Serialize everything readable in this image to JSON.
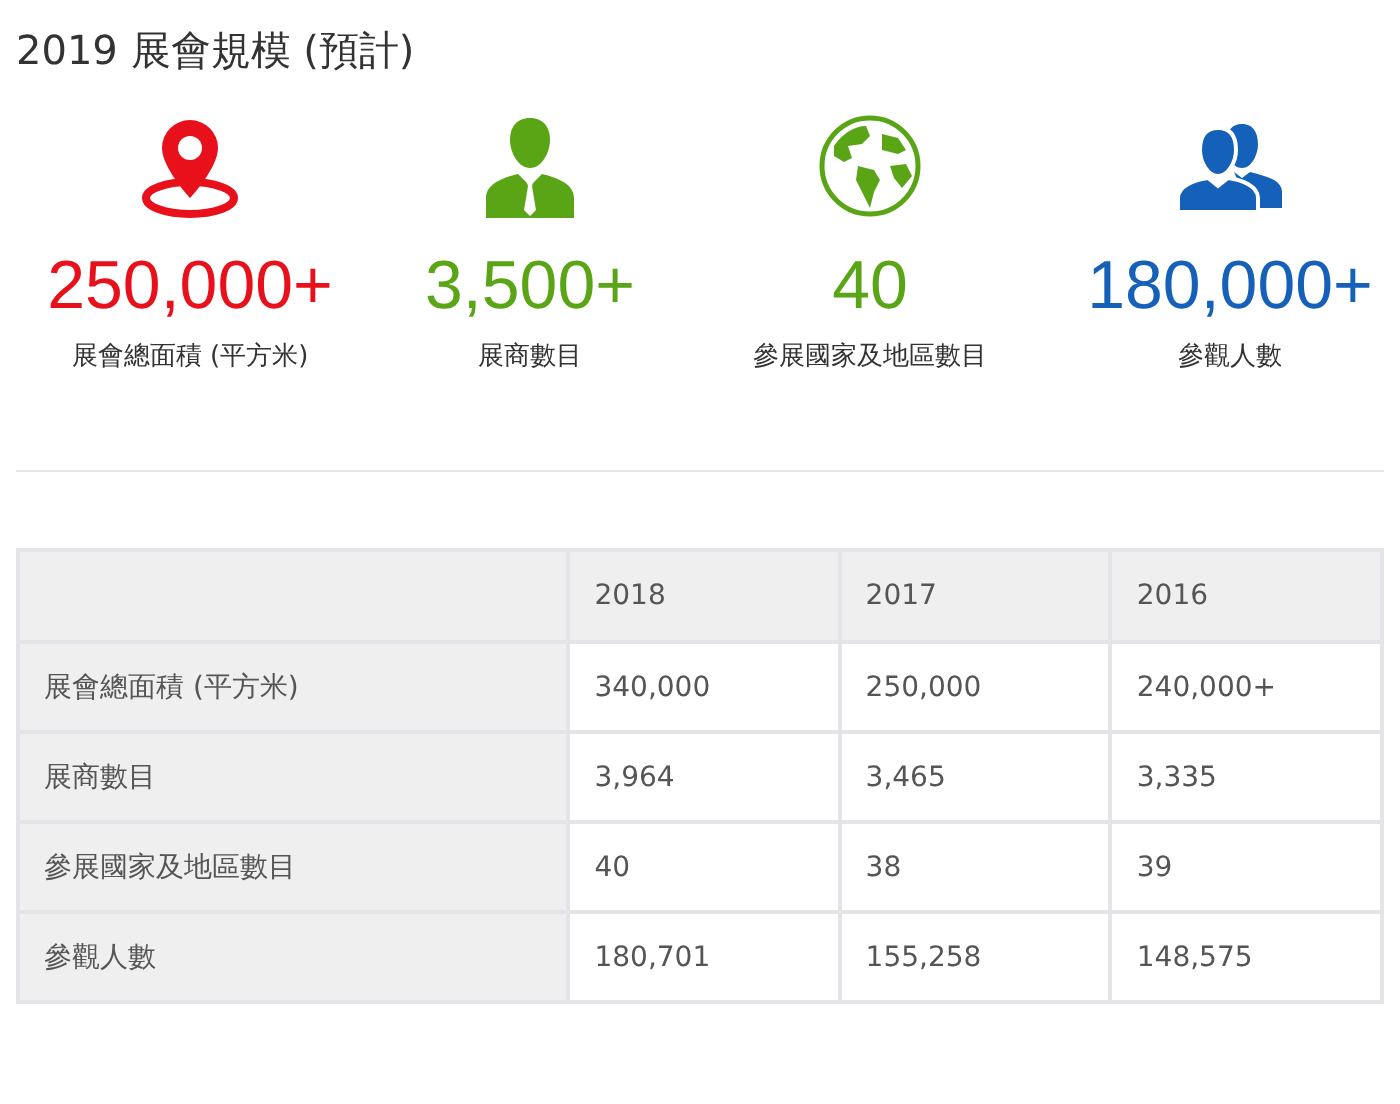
{
  "title": "2019 展會規模 (預計)",
  "stats": [
    {
      "kind": "pin",
      "color": "#e8101a",
      "value": "250,000+",
      "label": "展會總面積 (平方米)"
    },
    {
      "kind": "person",
      "color": "#5aa515",
      "value": "3,500+",
      "label": "展商數目"
    },
    {
      "kind": "globe",
      "color": "#5aa515",
      "value": "40",
      "label": "參展國家及地區數目"
    },
    {
      "kind": "people",
      "color": "#1560b8",
      "value": "180,000+",
      "label": "參觀人數"
    }
  ],
  "table": {
    "columns": [
      "2018",
      "2017",
      "2016"
    ],
    "rows": [
      {
        "label": "展會總面積 (平方米)",
        "cells": [
          "340,000",
          "250,000",
          "240,000+"
        ]
      },
      {
        "label": "展商數目",
        "cells": [
          "3,964",
          "3,465",
          "3,335"
        ]
      },
      {
        "label": "參展國家及地區數目",
        "cells": [
          "40",
          "38",
          "39"
        ]
      },
      {
        "label": "參觀人數",
        "cells": [
          "180,701",
          "155,258",
          "148,575"
        ]
      }
    ]
  }
}
